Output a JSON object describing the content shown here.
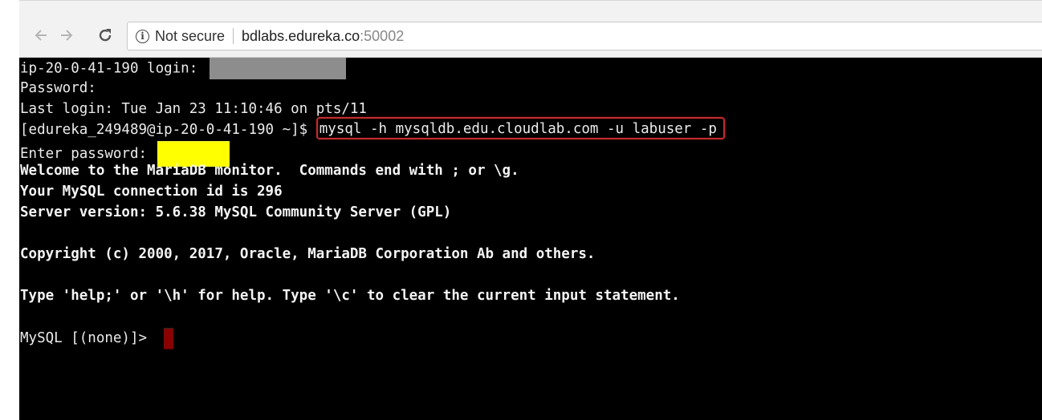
{
  "browser": {
    "back_icon": "arrow-left-icon",
    "forward_icon": "arrow-right-icon",
    "reload_icon": "reload-icon",
    "info_icon": "info-circle-icon",
    "info_glyph": "i",
    "security_label": "Not secure",
    "url_host": "bdlabs.edureka.co",
    "url_port": ":50002"
  },
  "terminal": {
    "login_prompt": "ip-20-0-41-190 login: ",
    "password_prompt": "Password:",
    "last_login": "Last login: Tue Jan 23 11:10:46 on pts/11",
    "shell_prompt": "[edureka_249489@ip-20-0-41-190 ~]$ ",
    "command": "mysql -h mysqldb.edu.cloudlab.com -u labuser -p",
    "enter_password": "Enter password: ",
    "welcome": "Welcome to the MariaDB monitor.  Commands end with ; or \\g.",
    "connection_id": "Your MySQL connection id is 296",
    "server_version": "Server version: 5.6.38 MySQL Community Server (GPL)",
    "copyright": "Copyright (c) 2000, 2017, Oracle, MariaDB Corporation Ab and others.",
    "help_text": "Type 'help;' or '\\h' for help. Type '\\c' to clear the current input statement.",
    "mysql_prompt": "MySQL [(none)]> "
  },
  "colors": {
    "terminal_bg": "#000000",
    "terminal_fg": "#ebebeb",
    "highlight_box": "#e0201e",
    "password_mask": "#ffff00",
    "login_mask": "#8d8d8d",
    "cursor": "#8b0000"
  }
}
